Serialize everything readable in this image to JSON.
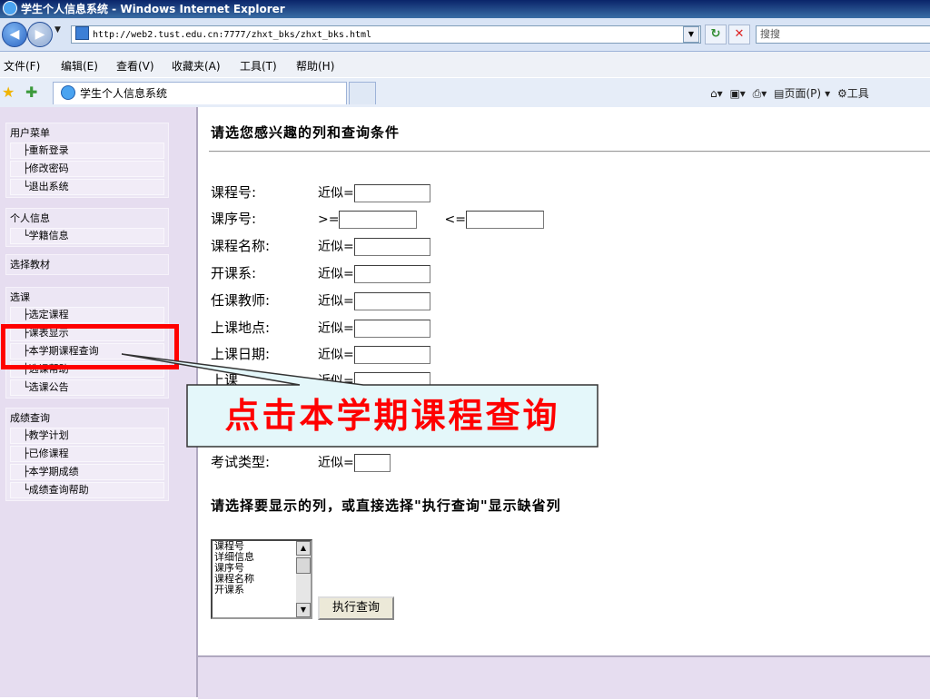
{
  "window": {
    "title": "学生个人信息系统 - Windows Internet Explorer"
  },
  "address_bar": {
    "url": "http://web2.tust.edu.cn:7777/zhxt_bks/zhxt_bks.html",
    "search_placeholder": "搜搜"
  },
  "menu_bar": [
    "文件(F)",
    "编辑(E)",
    "查看(V)",
    "收藏夹(A)",
    "工具(T)",
    "帮助(H)"
  ],
  "tab": {
    "title": "学生个人信息系统"
  },
  "command_bar": {
    "page_label": "页面(P)",
    "tools_label": "工具"
  },
  "sidebar": {
    "groups": [
      {
        "title": "用户菜单",
        "items": [
          "├重新登录",
          "├修改密码",
          "└退出系统"
        ]
      },
      {
        "title": "个人信息",
        "items": [
          "└学籍信息"
        ]
      },
      {
        "title": "选择教材",
        "items": []
      },
      {
        "title": "选课",
        "items": [
          "├选定课程",
          "├课表显示",
          "├本学期课程查询",
          "├选课帮助",
          "└选课公告"
        ]
      },
      {
        "title": "成绩查询",
        "items": [
          "├教学计划",
          "├已修课程",
          "├本学期成绩",
          "└成绩查询帮助"
        ]
      }
    ]
  },
  "main": {
    "heading": "请选您感兴趣的列和查询条件",
    "fields": [
      {
        "label": "课程号:",
        "op": "近似="
      },
      {
        "label": "课序号:",
        "op": ">=",
        "op2": "<="
      },
      {
        "label": "课程名称:",
        "op": "近似="
      },
      {
        "label": "开课系:",
        "op": "近似="
      },
      {
        "label": "任课教师:",
        "op": "近似="
      },
      {
        "label": "上课地点:",
        "op": "近似="
      },
      {
        "label": "上课日期:",
        "op": "近似="
      },
      {
        "label": "上课",
        "op": "近似="
      },
      {
        "label": "考试类型:",
        "op": "近似="
      }
    ],
    "heading2": "请选择要显示的列，或直接选择\"执行查询\"显示缺省列",
    "column_options": [
      "课程号",
      "详细信息",
      "课序号",
      "课程名称",
      "开课系"
    ],
    "execute_button": "执行查询"
  },
  "annotation": {
    "callout_text": "点击本学期课程查询"
  }
}
